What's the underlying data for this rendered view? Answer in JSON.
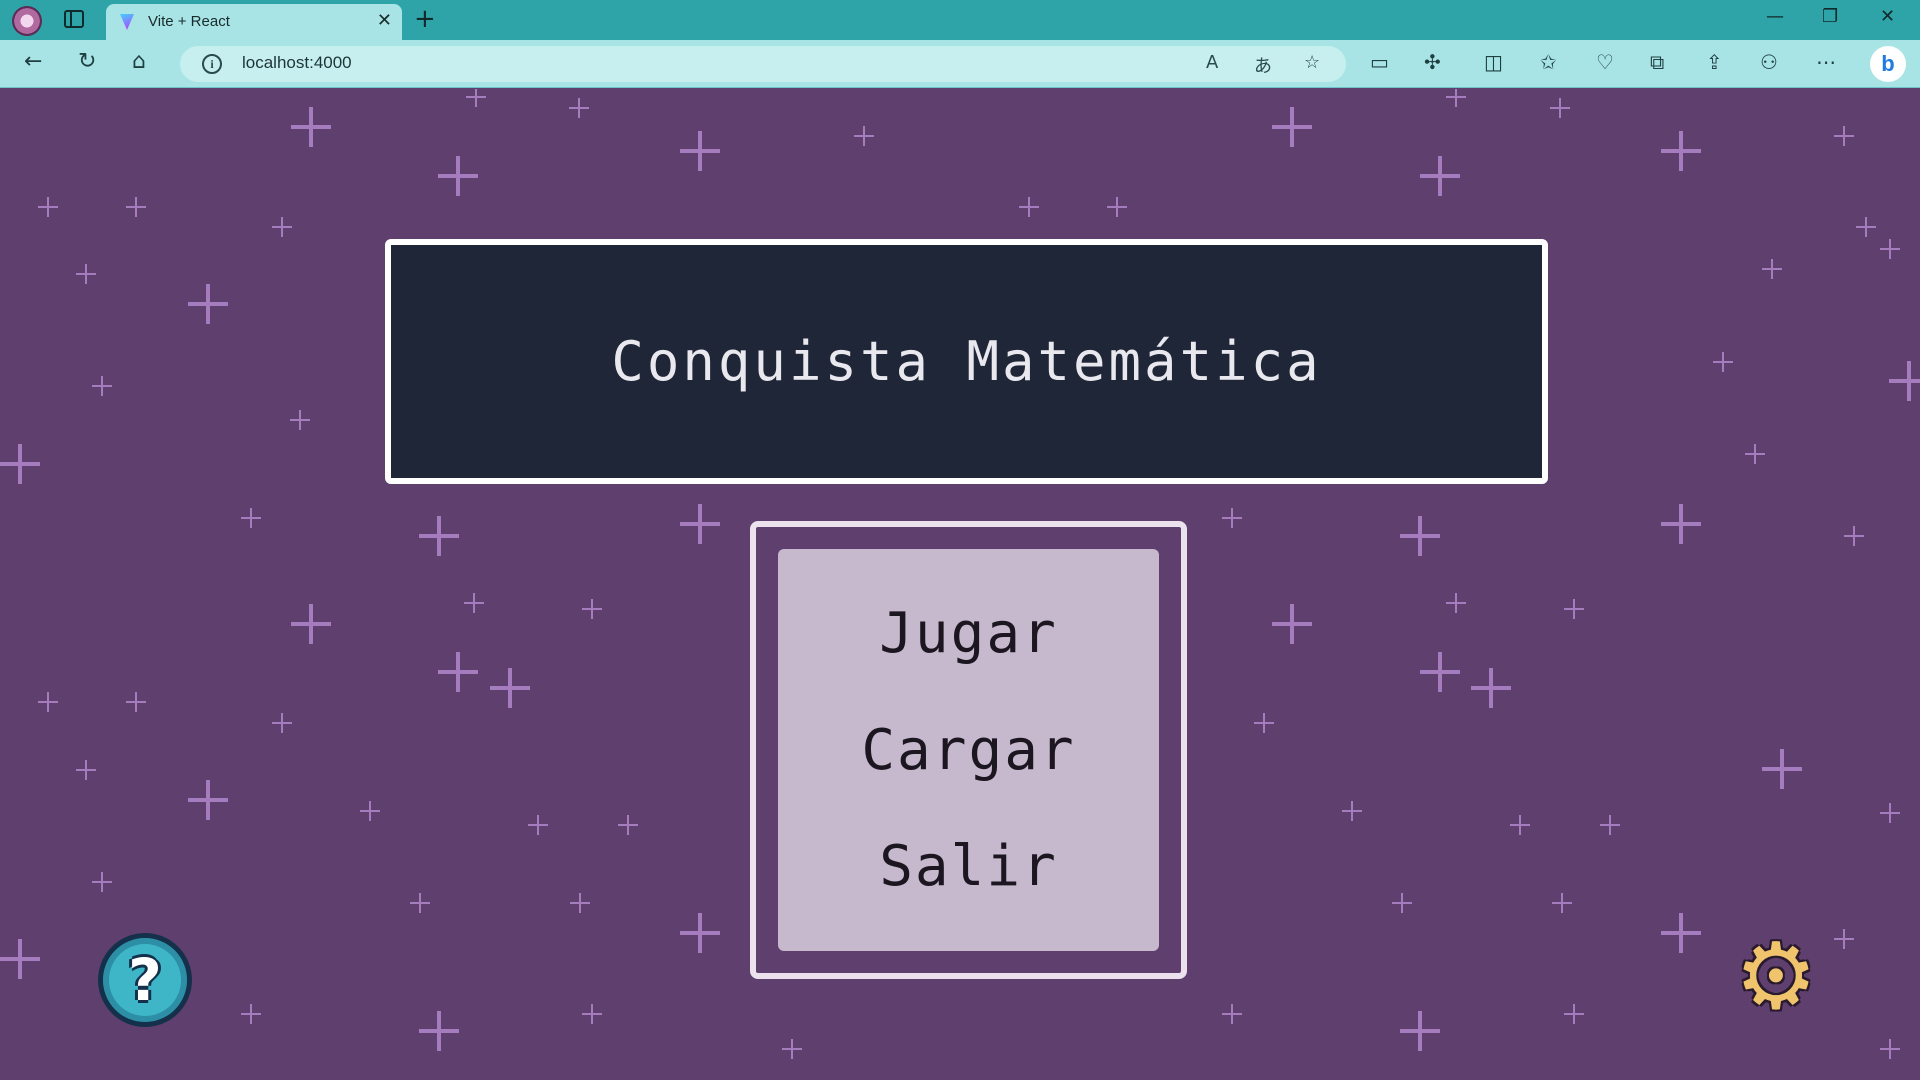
{
  "browser": {
    "tab_title": "Vite + React",
    "tab_close": "✕",
    "new_tab": "+",
    "url": "localhost:4000",
    "window_controls": {
      "minimize": "—",
      "restore": "❐",
      "close": "✕"
    },
    "icons": [
      "profile-icon",
      "tab-actions-icon",
      "back-icon",
      "refresh-icon",
      "home-icon",
      "site-info-icon",
      "read-aloud-icon",
      "translate-icon",
      "favorite-icon",
      "reading-view-icon",
      "extensions-icon",
      "split-screen-icon",
      "favorites-icon",
      "browser-essentials-icon",
      "collections-icon",
      "share-icon",
      "performance-icon",
      "more-icon",
      "bing-copilot-icon"
    ]
  },
  "game": {
    "title": "Conquista Matemática",
    "menu": [
      {
        "label": "Jugar"
      },
      {
        "label": "Cargar"
      },
      {
        "label": "Salir"
      }
    ],
    "help_glyph": "?",
    "settings_glyph": "⚙"
  },
  "colors": {
    "background": "#5f3f6d",
    "star": "#a57cbd",
    "title_panel": "#1f2638",
    "menu_panel": "#c6b8cd",
    "browser_tabbar": "#2ea4a9",
    "browser_toolbar": "#a8e4e6"
  }
}
